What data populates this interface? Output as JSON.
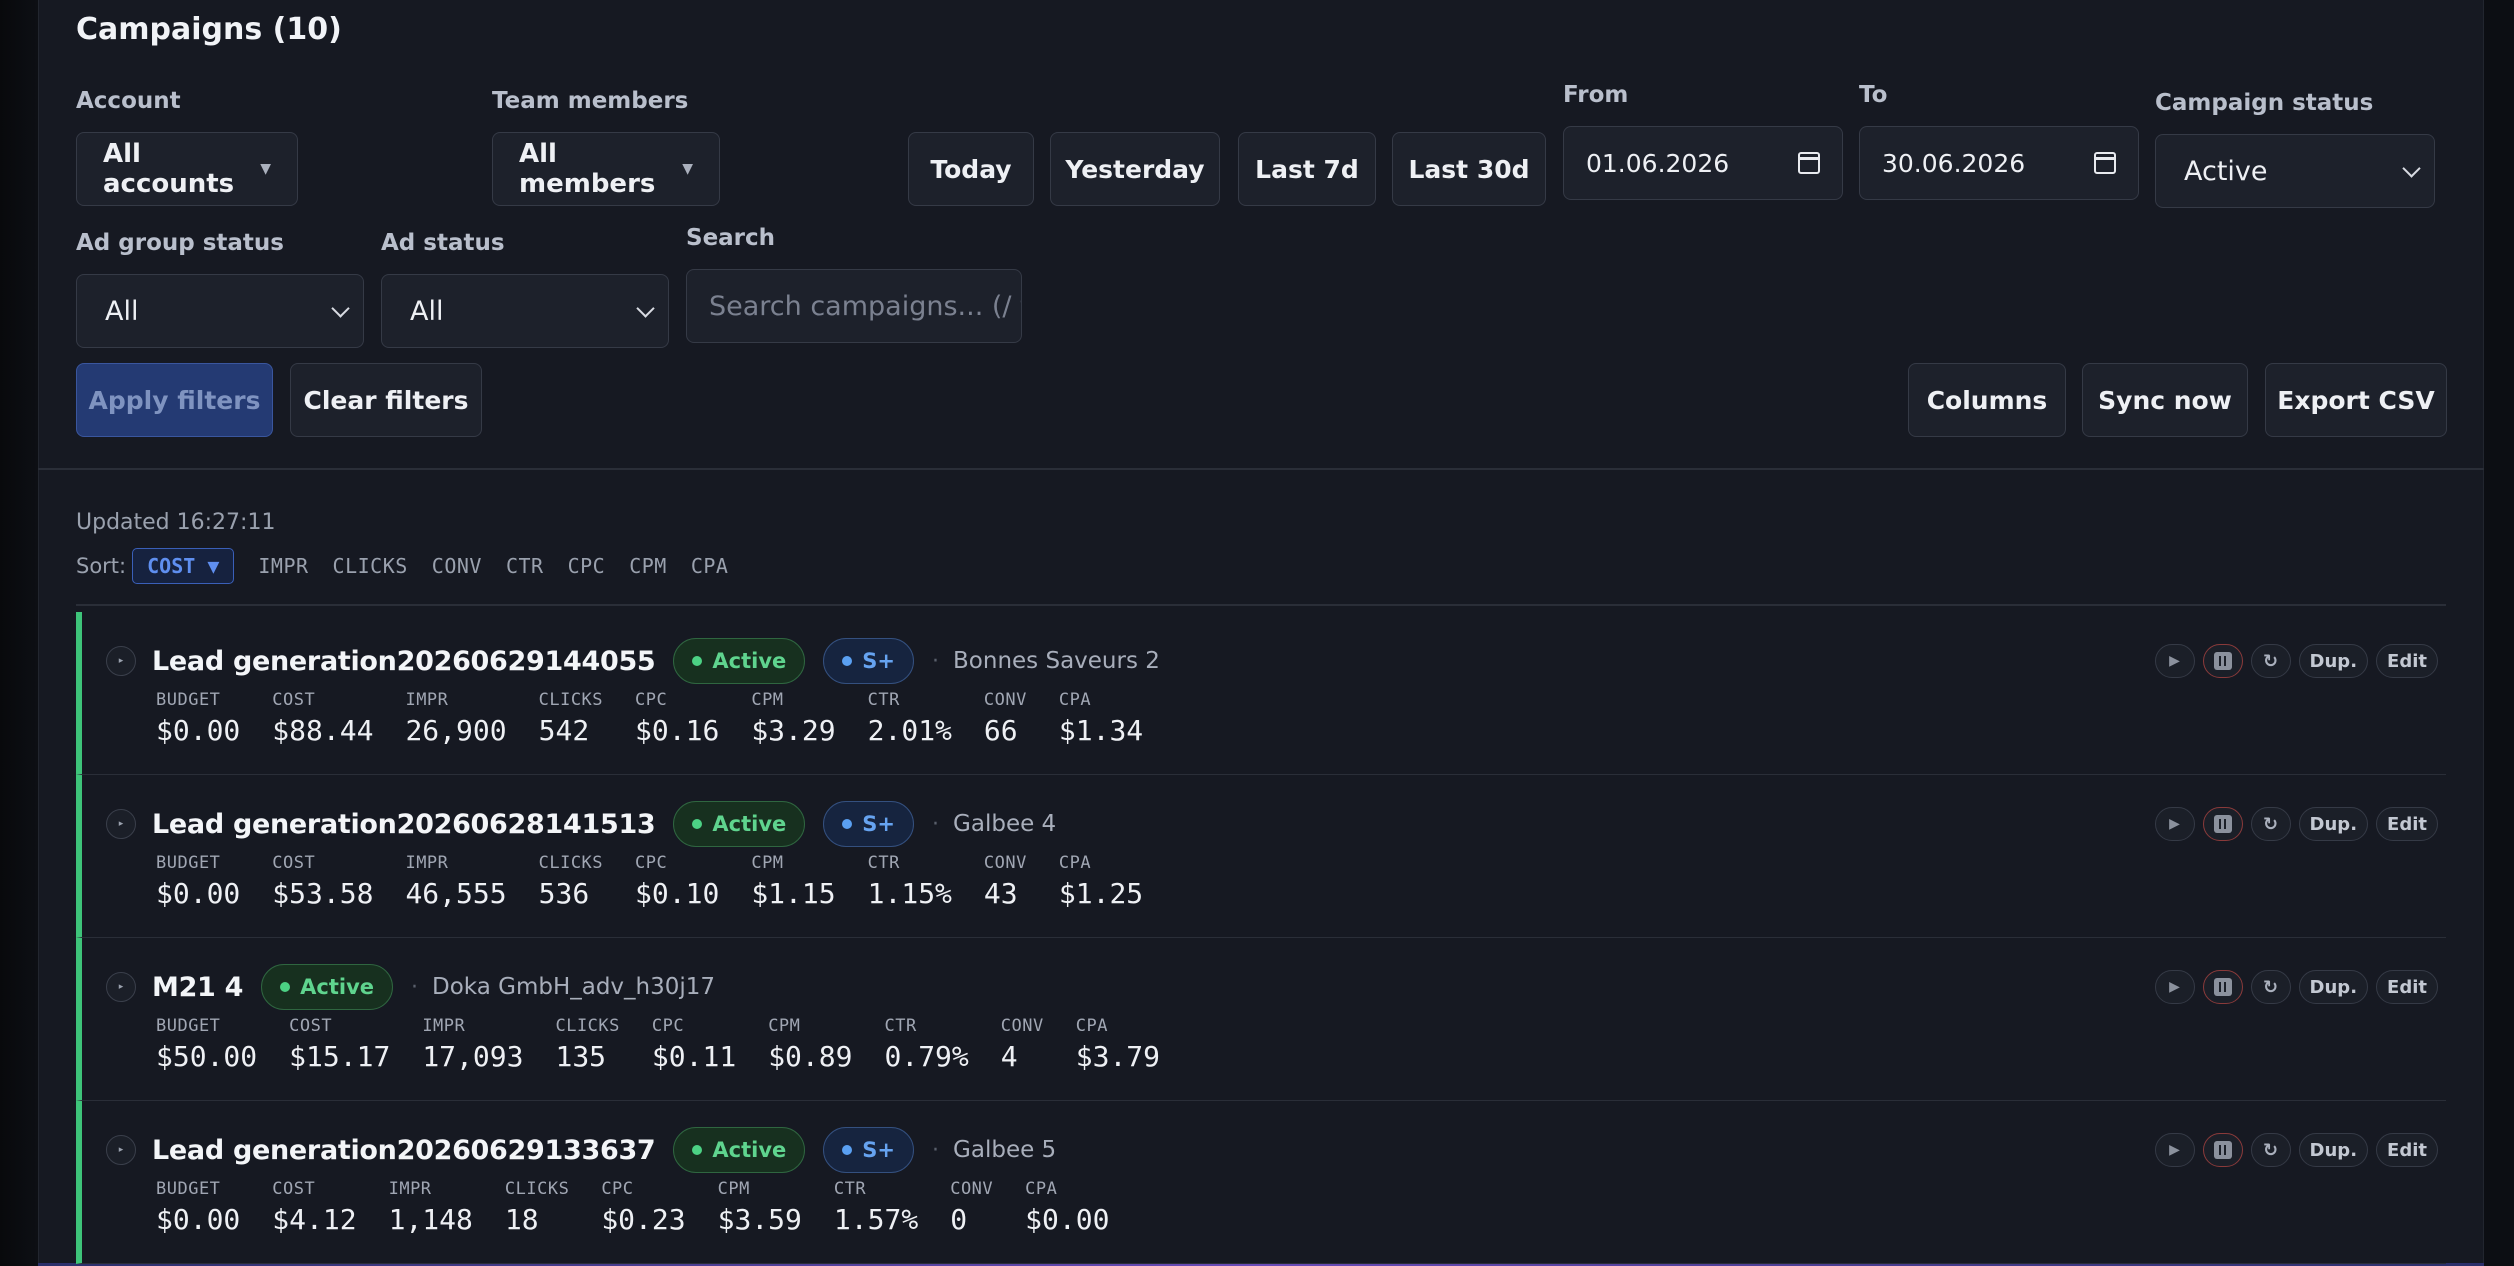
{
  "header": {
    "title": "Campaigns (10)"
  },
  "filters": {
    "account": {
      "label": "Account",
      "value": "All accounts"
    },
    "team": {
      "label": "Team members",
      "value": "All members"
    },
    "quick_ranges": [
      "Today",
      "Yesterday",
      "Last 7d",
      "Last 30d"
    ],
    "from": {
      "label": "From",
      "value": "01.06.2026"
    },
    "to": {
      "label": "To",
      "value": "30.06.2026"
    },
    "campaign_status": {
      "label": "Campaign status",
      "value": "Active"
    },
    "ad_group_status": {
      "label": "Ad group status",
      "value": "All"
    },
    "ad_status": {
      "label": "Ad status",
      "value": "All"
    },
    "search": {
      "label": "Search",
      "placeholder": "Search campaigns... (/ t"
    },
    "apply_label": "Apply filters",
    "clear_label": "Clear filters"
  },
  "toolbar": {
    "columns": "Columns",
    "sync": "Sync now",
    "export": "Export CSV"
  },
  "updated": "Updated 16:27:11",
  "sort": {
    "label": "Sort:",
    "active": "COST ▼",
    "options": [
      "IMPR",
      "CLICKS",
      "CONV",
      "CTR",
      "CPC",
      "CPM",
      "CPA"
    ]
  },
  "metric_labels": [
    "BUDGET",
    "COST",
    "IMPR",
    "CLICKS",
    "CPC",
    "CPM",
    "CTR",
    "CONV",
    "CPA"
  ],
  "actions": {
    "dup": "Dup.",
    "edit": "Edit"
  },
  "campaigns": [
    {
      "name": "Lead generation20260629144055",
      "status": "Active",
      "tag": "S+",
      "account": "Bonnes Saveurs 2",
      "values": [
        "$0.00",
        "$88.44",
        "26,900",
        "542",
        "$0.16",
        "$3.29",
        "2.01%",
        "66",
        "$1.34"
      ]
    },
    {
      "name": "Lead generation20260628141513",
      "status": "Active",
      "tag": "S+",
      "account": "Galbee 4",
      "values": [
        "$0.00",
        "$53.58",
        "46,555",
        "536",
        "$0.10",
        "$1.15",
        "1.15%",
        "43",
        "$1.25"
      ]
    },
    {
      "name": "M21 4",
      "status": "Active",
      "tag": "",
      "account": "Doka GmbH_adv_h30j17",
      "values": [
        "$50.00",
        "$15.17",
        "17,093",
        "135",
        "$0.11",
        "$0.89",
        "0.79%",
        "4",
        "$3.79"
      ]
    },
    {
      "name": "Lead generation20260629133637",
      "status": "Active",
      "tag": "S+",
      "account": "Galbee 5",
      "values": [
        "$0.00",
        "$4.12",
        "1,148",
        "18",
        "$0.23",
        "$3.59",
        "1.57%",
        "0",
        "$0.00"
      ]
    }
  ]
}
